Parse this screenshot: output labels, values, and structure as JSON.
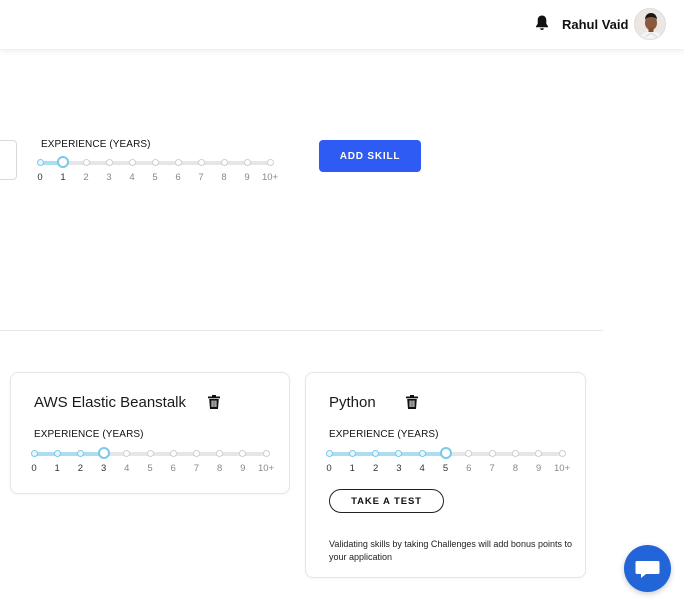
{
  "header": {
    "username": "Rahul Vaid",
    "icons": {
      "notifications": "bell-icon",
      "avatar": "user-avatar"
    }
  },
  "new_skill": {
    "experience_label": "EXPERIENCE (YEARS)",
    "add_button_label": "ADD SKILL",
    "experience_value": 1
  },
  "scale_labels": [
    "0",
    "1",
    "2",
    "3",
    "4",
    "5",
    "6",
    "7",
    "8",
    "9",
    "10+"
  ],
  "skills": [
    {
      "name": "AWS Elastic Beanstalk",
      "experience_label": "EXPERIENCE (YEARS)",
      "experience_value": 3,
      "delete_icon": "trash-icon"
    },
    {
      "name": "Python",
      "experience_label": "EXPERIENCE (YEARS)",
      "experience_value": 5,
      "delete_icon": "trash-icon",
      "test_button_label": "TAKE A TEST",
      "note": "Validating skills by taking Challenges will add bonus points to your application"
    }
  ],
  "chat": {
    "icon": "chat-bubble-icon"
  },
  "colors": {
    "primary": "#2d5bf4",
    "slider_fill": "#a9def5",
    "slider_thumb": "#7cc8ea",
    "chat": "#2265d8"
  }
}
